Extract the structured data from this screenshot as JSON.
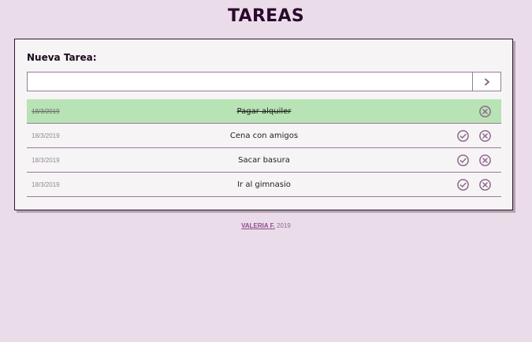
{
  "app": {
    "title": "TAREAS"
  },
  "form": {
    "label": "Nueva Tarea:",
    "input_value": "",
    "input_placeholder": "",
    "submit_icon": "chevron-right-icon"
  },
  "tasks": [
    {
      "date": "18/3/2019",
      "title": "Pagar alquiler",
      "done": true
    },
    {
      "date": "18/3/2019",
      "title": "Cena con amigos",
      "done": false
    },
    {
      "date": "18/3/2019",
      "title": "Sacar basura",
      "done": false
    },
    {
      "date": "18/3/2019",
      "title": "Ir al gimnasio",
      "done": false
    }
  ],
  "footer": {
    "author": "VALERIA F.",
    "year": "2019"
  },
  "colors": {
    "background": "#ebdcea",
    "card": "#f7f4f6",
    "done_row": "#b7e3b5",
    "accent": "#8d6a8d",
    "title": "#2a0a2c"
  }
}
